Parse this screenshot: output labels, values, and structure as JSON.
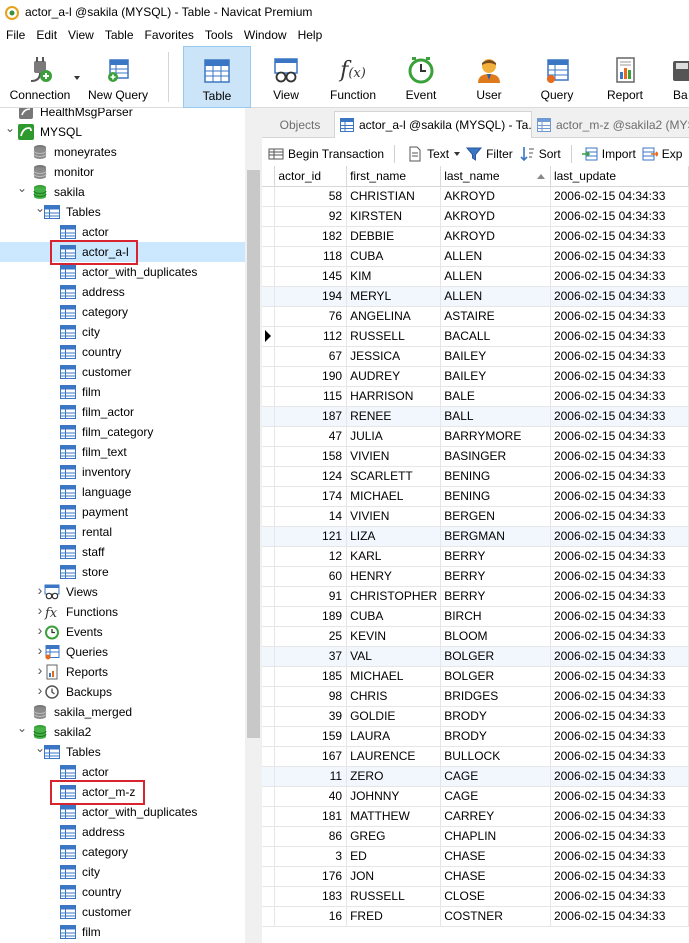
{
  "window": {
    "title": "actor_a-l @sakila (MYSQL) - Table - Navicat Premium"
  },
  "menu": [
    "File",
    "Edit",
    "View",
    "Table",
    "Favorites",
    "Tools",
    "Window",
    "Help"
  ],
  "toolbar": {
    "connection": "Connection",
    "new_query": "New Query",
    "table": "Table",
    "view": "View",
    "function": "Function",
    "event": "Event",
    "user": "User",
    "query": "Query",
    "report": "Report",
    "backup": "Ba"
  },
  "tree": {
    "health": "HealthMsgParser",
    "mysql": "MYSQL",
    "moneyrates": "moneyrates",
    "monitor": "monitor",
    "sakila": "sakila",
    "tables": "Tables",
    "sakila_tables": [
      "actor",
      "actor_a-l",
      "actor_with_duplicates",
      "address",
      "category",
      "city",
      "country",
      "customer",
      "film",
      "film_actor",
      "film_category",
      "film_text",
      "inventory",
      "language",
      "payment",
      "rental",
      "staff",
      "store"
    ],
    "views": "Views",
    "functions": "Functions",
    "events": "Events",
    "queries": "Queries",
    "reports": "Reports",
    "backups": "Backups",
    "sakila_merged": "sakila_merged",
    "sakila2": "sakila2",
    "tables2": "Tables",
    "sakila2_tables": [
      "actor",
      "actor_m-z",
      "actor_with_duplicates",
      "address",
      "category",
      "city",
      "country",
      "customer",
      "film"
    ]
  },
  "tabs": {
    "objects": "Objects",
    "active": "actor_a-l @sakila (MYSQL) - Ta...",
    "other": "actor_m-z @sakila2 (MYS"
  },
  "grid_toolbar": {
    "begin_transaction": "Begin Transaction",
    "text": "Text",
    "filter": "Filter",
    "sort": "Sort",
    "import": "Import",
    "export": "Exp"
  },
  "grid": {
    "columns": [
      "actor_id",
      "first_name",
      "last_name",
      "last_update"
    ],
    "rows": [
      [
        "58",
        "CHRISTIAN",
        "AKROYD",
        "2006-02-15 04:34:33"
      ],
      [
        "92",
        "KIRSTEN",
        "AKROYD",
        "2006-02-15 04:34:33"
      ],
      [
        "182",
        "DEBBIE",
        "AKROYD",
        "2006-02-15 04:34:33"
      ],
      [
        "118",
        "CUBA",
        "ALLEN",
        "2006-02-15 04:34:33"
      ],
      [
        "145",
        "KIM",
        "ALLEN",
        "2006-02-15 04:34:33"
      ],
      [
        "194",
        "MERYL",
        "ALLEN",
        "2006-02-15 04:34:33"
      ],
      [
        "76",
        "ANGELINA",
        "ASTAIRE",
        "2006-02-15 04:34:33"
      ],
      [
        "112",
        "RUSSELL",
        "BACALL",
        "2006-02-15 04:34:33"
      ],
      [
        "67",
        "JESSICA",
        "BAILEY",
        "2006-02-15 04:34:33"
      ],
      [
        "190",
        "AUDREY",
        "BAILEY",
        "2006-02-15 04:34:33"
      ],
      [
        "115",
        "HARRISON",
        "BALE",
        "2006-02-15 04:34:33"
      ],
      [
        "187",
        "RENEE",
        "BALL",
        "2006-02-15 04:34:33"
      ],
      [
        "47",
        "JULIA",
        "BARRYMORE",
        "2006-02-15 04:34:33"
      ],
      [
        "158",
        "VIVIEN",
        "BASINGER",
        "2006-02-15 04:34:33"
      ],
      [
        "124",
        "SCARLETT",
        "BENING",
        "2006-02-15 04:34:33"
      ],
      [
        "174",
        "MICHAEL",
        "BENING",
        "2006-02-15 04:34:33"
      ],
      [
        "14",
        "VIVIEN",
        "BERGEN",
        "2006-02-15 04:34:33"
      ],
      [
        "121",
        "LIZA",
        "BERGMAN",
        "2006-02-15 04:34:33"
      ],
      [
        "12",
        "KARL",
        "BERRY",
        "2006-02-15 04:34:33"
      ],
      [
        "60",
        "HENRY",
        "BERRY",
        "2006-02-15 04:34:33"
      ],
      [
        "91",
        "CHRISTOPHER",
        "BERRY",
        "2006-02-15 04:34:33"
      ],
      [
        "189",
        "CUBA",
        "BIRCH",
        "2006-02-15 04:34:33"
      ],
      [
        "25",
        "KEVIN",
        "BLOOM",
        "2006-02-15 04:34:33"
      ],
      [
        "37",
        "VAL",
        "BOLGER",
        "2006-02-15 04:34:33"
      ],
      [
        "185",
        "MICHAEL",
        "BOLGER",
        "2006-02-15 04:34:33"
      ],
      [
        "98",
        "CHRIS",
        "BRIDGES",
        "2006-02-15 04:34:33"
      ],
      [
        "39",
        "GOLDIE",
        "BRODY",
        "2006-02-15 04:34:33"
      ],
      [
        "159",
        "LAURA",
        "BRODY",
        "2006-02-15 04:34:33"
      ],
      [
        "167",
        "LAURENCE",
        "BULLOCK",
        "2006-02-15 04:34:33"
      ],
      [
        "11",
        "ZERO",
        "CAGE",
        "2006-02-15 04:34:33"
      ],
      [
        "40",
        "JOHNNY",
        "CAGE",
        "2006-02-15 04:34:33"
      ],
      [
        "181",
        "MATTHEW",
        "CARREY",
        "2006-02-15 04:34:33"
      ],
      [
        "86",
        "GREG",
        "CHAPLIN",
        "2006-02-15 04:34:33"
      ],
      [
        "3",
        "ED",
        "CHASE",
        "2006-02-15 04:34:33"
      ],
      [
        "176",
        "JON",
        "CHASE",
        "2006-02-15 04:34:33"
      ],
      [
        "183",
        "RUSSELL",
        "CLOSE",
        "2006-02-15 04:34:33"
      ],
      [
        "16",
        "FRED",
        "COSTNER",
        "2006-02-15 04:34:33"
      ]
    ]
  }
}
